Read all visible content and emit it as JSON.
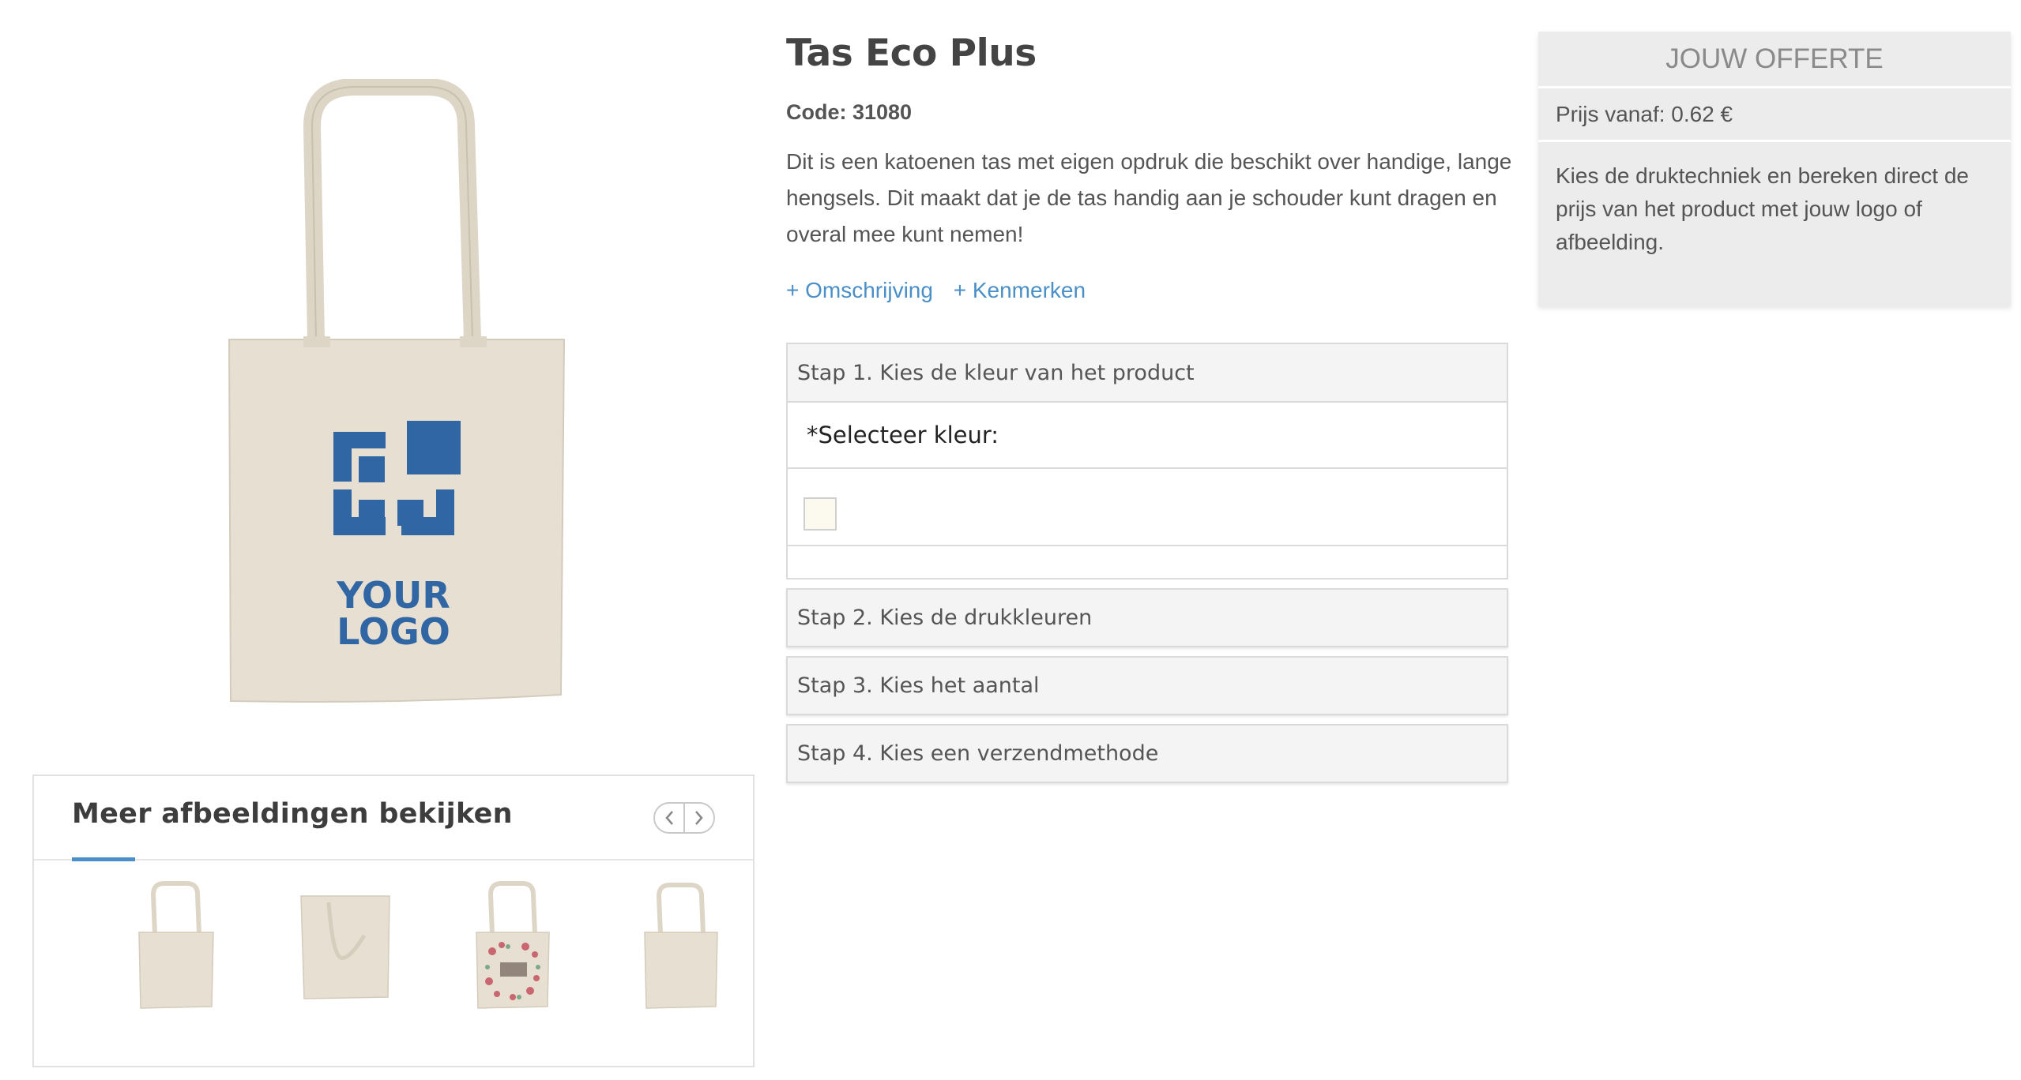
{
  "product": {
    "title": "Tas Eco Plus",
    "code": "Code: 31080",
    "description": "Dit is een katoenen tas met eigen opdruk die beschikt over handige, lange hengsels. Dit maakt dat je de tas handig aan je schouder kunt dragen en overal mee kunt nemen!",
    "links": [
      "+ Omschrijving",
      "+ Kenmerken"
    ],
    "logo_text_1": "YOUR",
    "logo_text_2": "LOGO",
    "bag_color": "#e6dfd2",
    "logo_color": "#2f66a3"
  },
  "gallery": {
    "title": "Meer afbeeldingen bekijken",
    "prev_icon": "chevron-left-icon",
    "next_icon": "chevron-right-icon",
    "accent": "#4a8fc7"
  },
  "steps": {
    "step1": "Stap 1. Kies de kleur van het product",
    "select_label": "*Selecteer kleur:",
    "swatch_color": "#fcfaee",
    "step2": "Stap 2. Kies de drukkleuren",
    "step3": "Stap 3. Kies het aantal",
    "step4": "Stap 4. Kies een verzendmethode"
  },
  "quote": {
    "title": "JOUW OFFERTE",
    "price": "Prijs vanaf: 0.62 €",
    "text": "Kies de druktechniek en bereken direct de prijs van het product met jouw logo of afbeelding."
  }
}
